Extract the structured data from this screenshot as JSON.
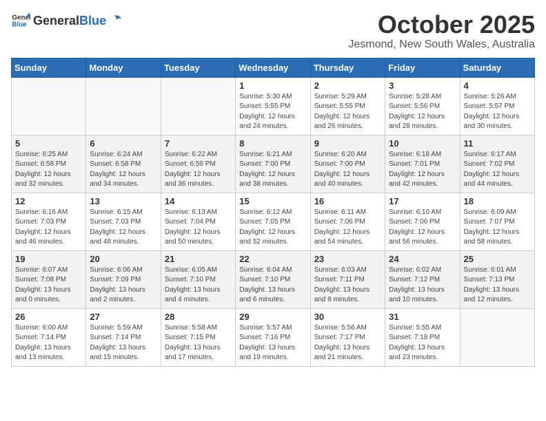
{
  "header": {
    "logo_general": "General",
    "logo_blue": "Blue",
    "month": "October 2025",
    "location": "Jesmond, New South Wales, Australia"
  },
  "weekdays": [
    "Sunday",
    "Monday",
    "Tuesday",
    "Wednesday",
    "Thursday",
    "Friday",
    "Saturday"
  ],
  "weeks": [
    [
      {
        "day": "",
        "info": ""
      },
      {
        "day": "",
        "info": ""
      },
      {
        "day": "",
        "info": ""
      },
      {
        "day": "1",
        "info": "Sunrise: 5:30 AM\nSunset: 5:55 PM\nDaylight: 12 hours\nand 24 minutes."
      },
      {
        "day": "2",
        "info": "Sunrise: 5:29 AM\nSunset: 5:55 PM\nDaylight: 12 hours\nand 26 minutes."
      },
      {
        "day": "3",
        "info": "Sunrise: 5:28 AM\nSunset: 5:56 PM\nDaylight: 12 hours\nand 28 minutes."
      },
      {
        "day": "4",
        "info": "Sunrise: 5:26 AM\nSunset: 5:57 PM\nDaylight: 12 hours\nand 30 minutes."
      }
    ],
    [
      {
        "day": "5",
        "info": "Sunrise: 6:25 AM\nSunset: 6:58 PM\nDaylight: 12 hours\nand 32 minutes."
      },
      {
        "day": "6",
        "info": "Sunrise: 6:24 AM\nSunset: 6:58 PM\nDaylight: 12 hours\nand 34 minutes."
      },
      {
        "day": "7",
        "info": "Sunrise: 6:22 AM\nSunset: 6:59 PM\nDaylight: 12 hours\nand 36 minutes."
      },
      {
        "day": "8",
        "info": "Sunrise: 6:21 AM\nSunset: 7:00 PM\nDaylight: 12 hours\nand 38 minutes."
      },
      {
        "day": "9",
        "info": "Sunrise: 6:20 AM\nSunset: 7:00 PM\nDaylight: 12 hours\nand 40 minutes."
      },
      {
        "day": "10",
        "info": "Sunrise: 6:18 AM\nSunset: 7:01 PM\nDaylight: 12 hours\nand 42 minutes."
      },
      {
        "day": "11",
        "info": "Sunrise: 6:17 AM\nSunset: 7:02 PM\nDaylight: 12 hours\nand 44 minutes."
      }
    ],
    [
      {
        "day": "12",
        "info": "Sunrise: 6:16 AM\nSunset: 7:03 PM\nDaylight: 12 hours\nand 46 minutes."
      },
      {
        "day": "13",
        "info": "Sunrise: 6:15 AM\nSunset: 7:03 PM\nDaylight: 12 hours\nand 48 minutes."
      },
      {
        "day": "14",
        "info": "Sunrise: 6:13 AM\nSunset: 7:04 PM\nDaylight: 12 hours\nand 50 minutes."
      },
      {
        "day": "15",
        "info": "Sunrise: 6:12 AM\nSunset: 7:05 PM\nDaylight: 12 hours\nand 52 minutes."
      },
      {
        "day": "16",
        "info": "Sunrise: 6:11 AM\nSunset: 7:06 PM\nDaylight: 12 hours\nand 54 minutes."
      },
      {
        "day": "17",
        "info": "Sunrise: 6:10 AM\nSunset: 7:06 PM\nDaylight: 12 hours\nand 56 minutes."
      },
      {
        "day": "18",
        "info": "Sunrise: 6:09 AM\nSunset: 7:07 PM\nDaylight: 12 hours\nand 58 minutes."
      }
    ],
    [
      {
        "day": "19",
        "info": "Sunrise: 6:07 AM\nSunset: 7:08 PM\nDaylight: 13 hours\nand 0 minutes."
      },
      {
        "day": "20",
        "info": "Sunrise: 6:06 AM\nSunset: 7:09 PM\nDaylight: 13 hours\nand 2 minutes."
      },
      {
        "day": "21",
        "info": "Sunrise: 6:05 AM\nSunset: 7:10 PM\nDaylight: 13 hours\nand 4 minutes."
      },
      {
        "day": "22",
        "info": "Sunrise: 6:04 AM\nSunset: 7:10 PM\nDaylight: 13 hours\nand 6 minutes."
      },
      {
        "day": "23",
        "info": "Sunrise: 6:03 AM\nSunset: 7:11 PM\nDaylight: 13 hours\nand 8 minutes."
      },
      {
        "day": "24",
        "info": "Sunrise: 6:02 AM\nSunset: 7:12 PM\nDaylight: 13 hours\nand 10 minutes."
      },
      {
        "day": "25",
        "info": "Sunrise: 6:01 AM\nSunset: 7:13 PM\nDaylight: 13 hours\nand 12 minutes."
      }
    ],
    [
      {
        "day": "26",
        "info": "Sunrise: 6:00 AM\nSunset: 7:14 PM\nDaylight: 13 hours\nand 13 minutes."
      },
      {
        "day": "27",
        "info": "Sunrise: 5:59 AM\nSunset: 7:14 PM\nDaylight: 13 hours\nand 15 minutes."
      },
      {
        "day": "28",
        "info": "Sunrise: 5:58 AM\nSunset: 7:15 PM\nDaylight: 13 hours\nand 17 minutes."
      },
      {
        "day": "29",
        "info": "Sunrise: 5:57 AM\nSunset: 7:16 PM\nDaylight: 13 hours\nand 19 minutes."
      },
      {
        "day": "30",
        "info": "Sunrise: 5:56 AM\nSunset: 7:17 PM\nDaylight: 13 hours\nand 21 minutes."
      },
      {
        "day": "31",
        "info": "Sunrise: 5:55 AM\nSunset: 7:18 PM\nDaylight: 13 hours\nand 23 minutes."
      },
      {
        "day": "",
        "info": ""
      }
    ]
  ]
}
